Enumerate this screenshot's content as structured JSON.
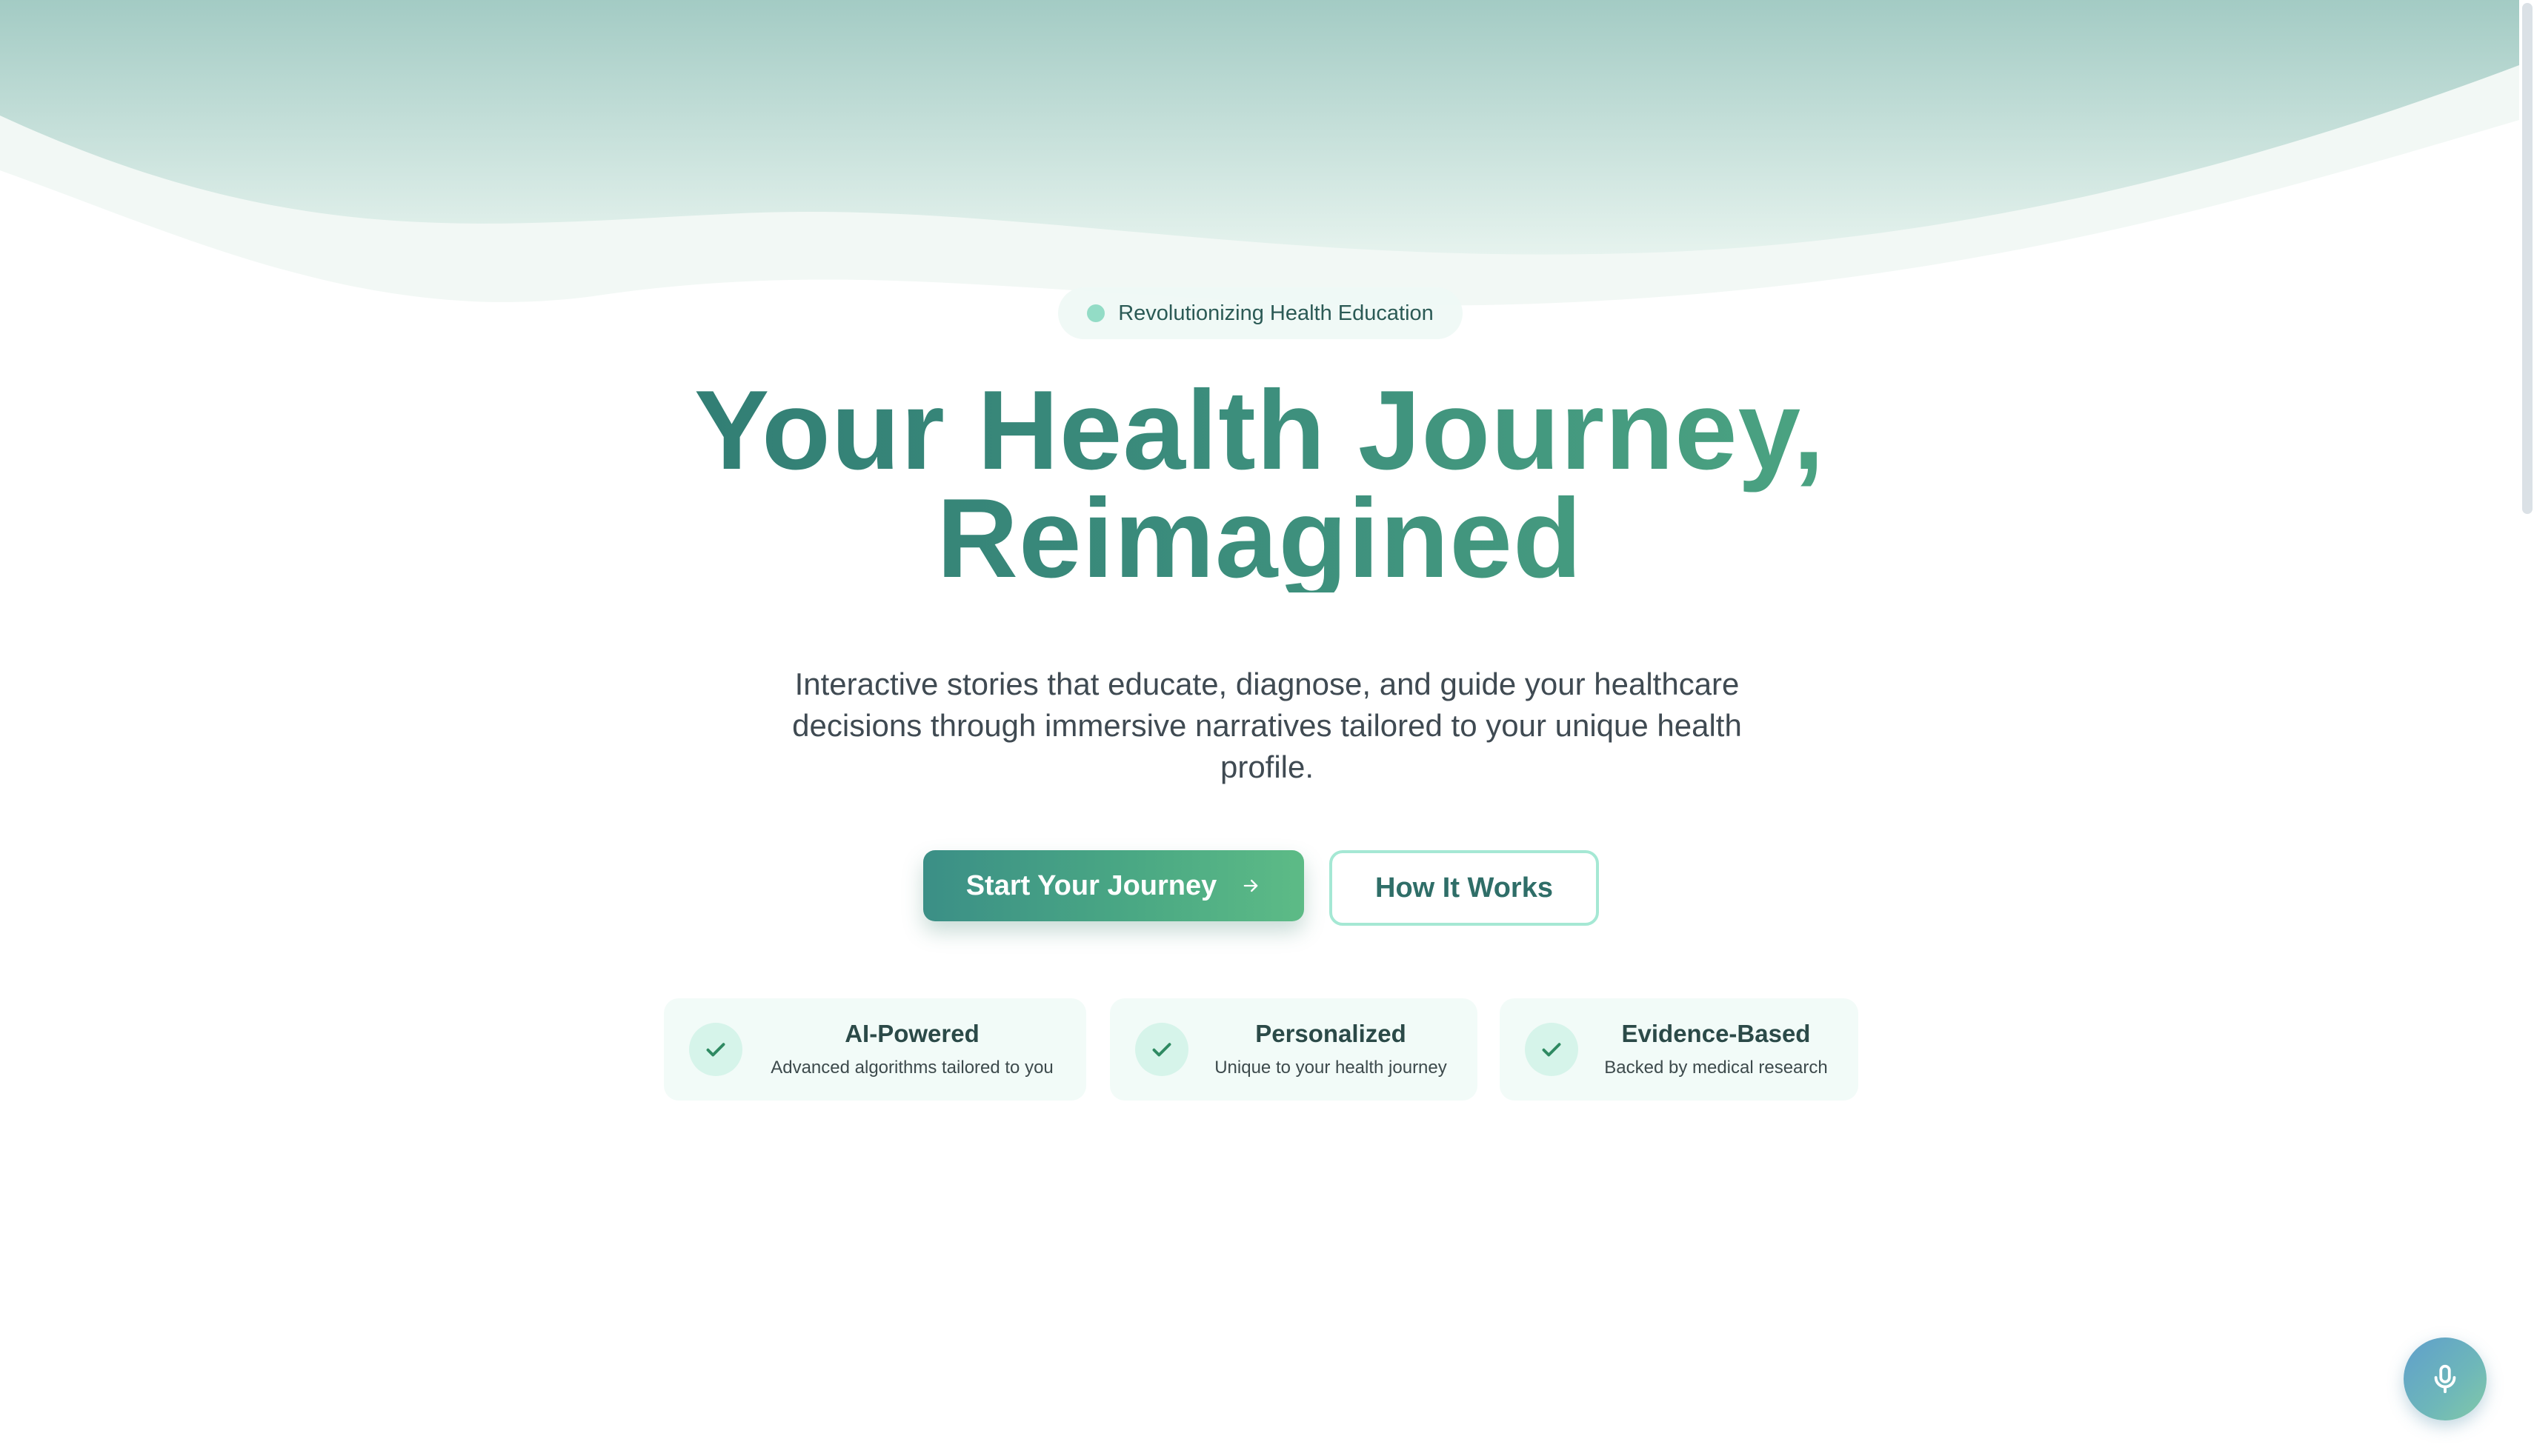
{
  "hero": {
    "badge_text": "Revolutionizing Health Education",
    "title_line1": "Your Health Journey,",
    "title_line2": "Reimagined",
    "subtitle": "Interactive stories that educate, diagnose, and guide your healthcare decisions through immersive narratives tailored to your unique health profile.",
    "primary_button_label": "Start Your Journey",
    "primary_button_icon": "arrow-right-icon",
    "secondary_button_label": "How It Works"
  },
  "features": [
    {
      "title": "AI-Powered",
      "description": "Advanced algorithms tailored to you",
      "icon": "check-icon"
    },
    {
      "title": "Personalized",
      "description": "Unique to your health journey",
      "icon": "check-icon"
    },
    {
      "title": "Evidence-Based",
      "description": "Backed by medical research",
      "icon": "check-icon"
    }
  ],
  "fab": {
    "icon": "microphone-icon"
  },
  "colors": {
    "brand_teal": "#3b8f86",
    "brand_green": "#5dbb86",
    "badge_dot": "#93dcc6",
    "outline": "#a5e8d4",
    "card_bg": "#f2fbf8",
    "text_dark": "#3f4a52"
  }
}
